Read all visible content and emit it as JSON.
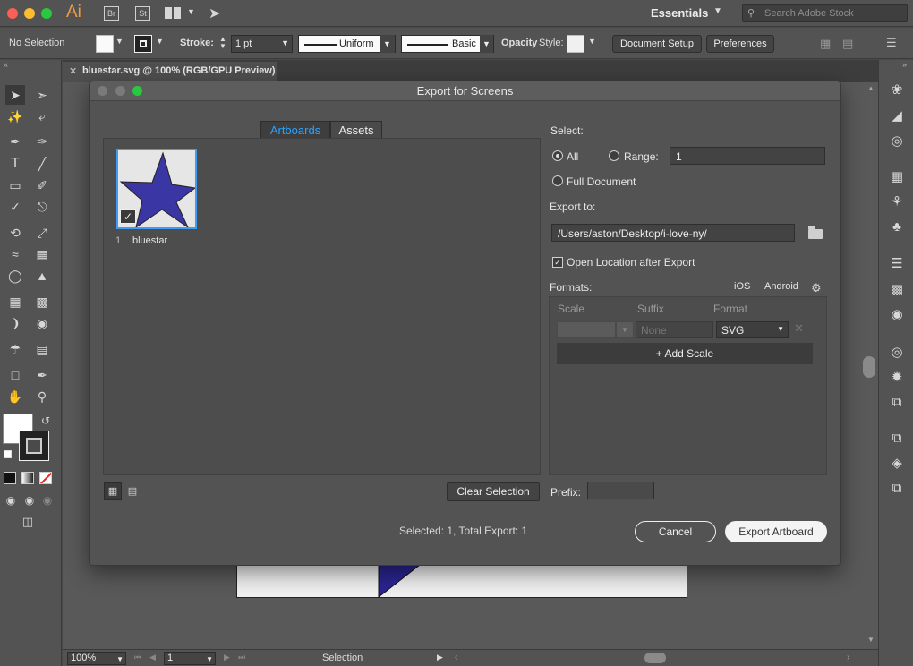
{
  "app": {
    "logo": "Ai",
    "bridge_badge": "Br",
    "stock_badge": "St",
    "workspace": "Essentials",
    "search_placeholder": "Search Adobe Stock"
  },
  "control_bar": {
    "selection": "No Selection",
    "stroke_label": "Stroke:",
    "stroke_value": "1 pt",
    "uniform_label": "Uniform",
    "basic_label": "Basic",
    "opacity_label": "Opacity",
    "style_label": "Style:",
    "document_setup": "Document Setup",
    "preferences": "Preferences"
  },
  "document_tab": {
    "title": "bluestar.svg @ 100% (RGB/GPU Preview)"
  },
  "status_bar": {
    "zoom": "100%",
    "page": "1",
    "tool": "Selection"
  },
  "dialog": {
    "title": "Export for Screens",
    "tabs": {
      "artboards": "Artboards",
      "assets": "Assets"
    },
    "artboard": {
      "number": "1",
      "name": "bluestar",
      "fill": "#3a36a3"
    },
    "clear_selection": "Clear Selection",
    "select_label": "Select:",
    "all_label": "All",
    "range_label": "Range:",
    "range_value": "1",
    "full_document_label": "Full Document",
    "export_to_label": "Export to:",
    "export_path": "/Users/aston/Desktop/i-love-ny/",
    "open_location_label": "Open Location after Export",
    "formats_label": "Formats:",
    "ios_label": "iOS",
    "android_label": "Android",
    "scale_header": "Scale",
    "suffix_header": "Suffix",
    "format_header": "Format",
    "suffix_placeholder": "None",
    "format_value": "SVG",
    "add_scale": "+ Add Scale",
    "prefix_label": "Prefix:",
    "selection_info": "Selected: 1, Total Export: 1",
    "cancel": "Cancel",
    "export_button": "Export Artboard"
  }
}
